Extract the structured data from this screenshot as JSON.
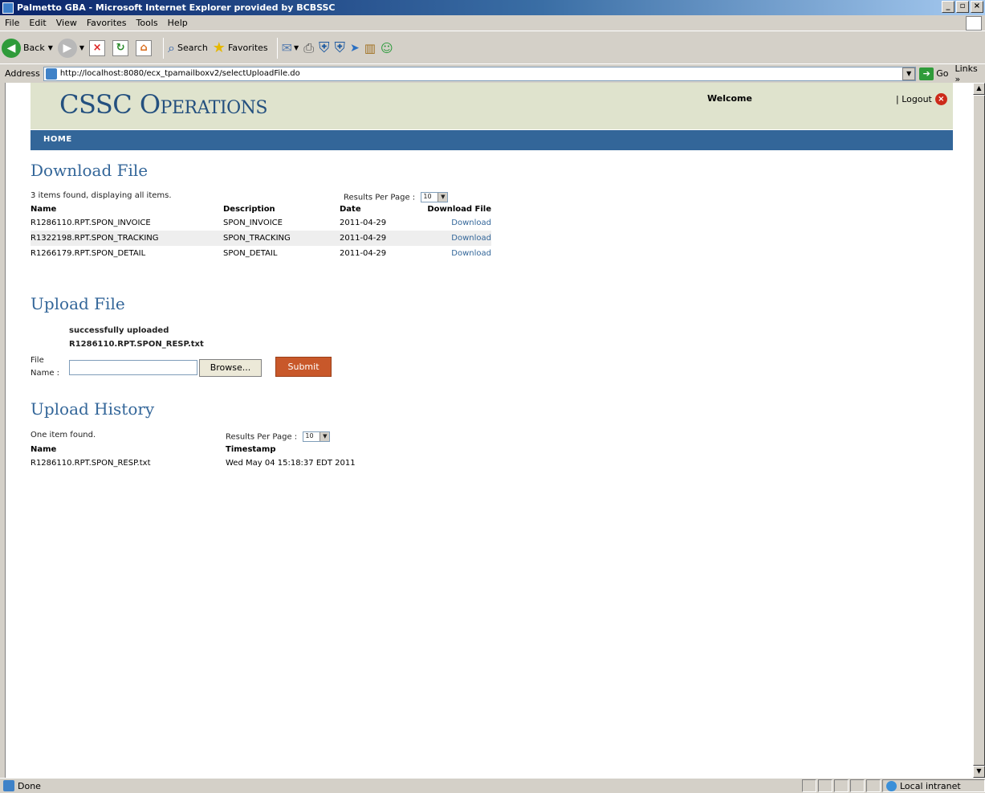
{
  "window": {
    "title": "Palmetto GBA - Microsoft Internet Explorer provided by BCBSSC"
  },
  "menu": {
    "items": [
      "File",
      "Edit",
      "View",
      "Favorites",
      "Tools",
      "Help"
    ]
  },
  "toolbar": {
    "back": "Back",
    "search": "Search",
    "favorites": "Favorites"
  },
  "address": {
    "label": "Address",
    "url": "http://localhost:8080/ecx_tpamailboxv2/selectUploadFile.do",
    "go": "Go",
    "links": "Links"
  },
  "header": {
    "brand": "CSSC Operations",
    "welcome": "Welcome",
    "logout": "| Logout"
  },
  "nav": {
    "home": "HOME"
  },
  "download": {
    "title": "Download File",
    "summary": "3 items found, displaying all items.",
    "results_per_page_label": "Results Per Page :",
    "results_per_page_value": "10",
    "columns": [
      "Name",
      "Description",
      "Date",
      "Download File"
    ],
    "rows": [
      {
        "name": "R1286110.RPT.SPON_INVOICE",
        "description": "SPON_INVOICE",
        "date": "2011-04-29",
        "link": "Download"
      },
      {
        "name": "R1322198.RPT.SPON_TRACKING",
        "description": "SPON_TRACKING",
        "date": "2011-04-29",
        "link": "Download"
      },
      {
        "name": "R1266179.RPT.SPON_DETAIL",
        "description": "SPON_DETAIL",
        "date": "2011-04-29",
        "link": "Download"
      }
    ]
  },
  "upload": {
    "title": "Upload File",
    "message_line1": "successfully uploaded",
    "message_line2": "R1286110.RPT.SPON_RESP.txt",
    "file_label_1": "File",
    "file_label_2": "Name :",
    "browse": "Browse...",
    "submit": "Submit"
  },
  "history": {
    "title": "Upload History",
    "summary": "One item found.",
    "results_per_page_label": "Results Per Page :",
    "results_per_page_value": "10",
    "columns": [
      "Name",
      "Timestamp"
    ],
    "rows": [
      {
        "name": "R1286110.RPT.SPON_RESP.txt",
        "timestamp": "Wed May 04 15:18:37 EDT 2011"
      }
    ]
  },
  "status": {
    "text": "Done",
    "zone": "Local intranet"
  }
}
